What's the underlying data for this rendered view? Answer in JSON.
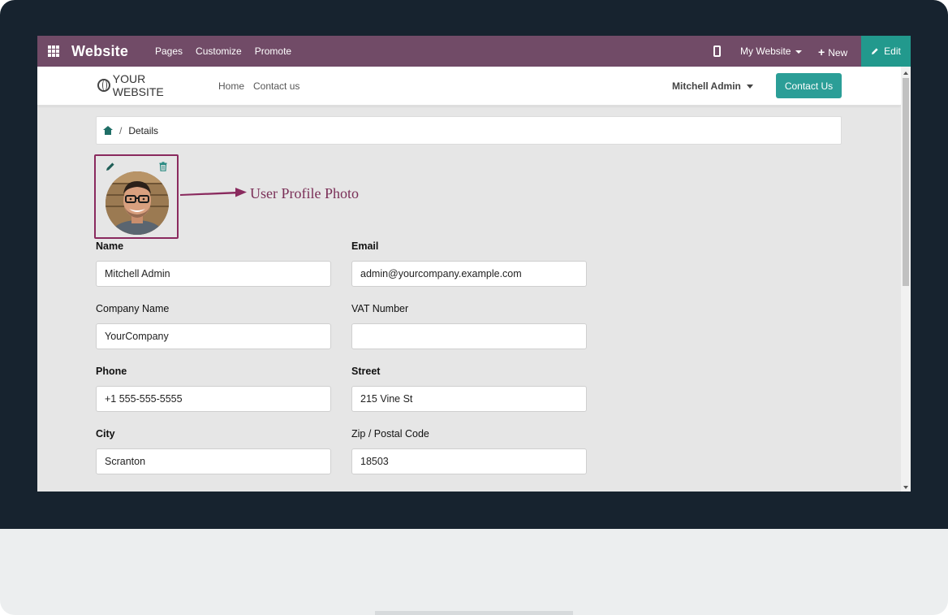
{
  "topbar": {
    "brand": "Website",
    "nav": [
      "Pages",
      "Customize",
      "Promote"
    ],
    "site_selector": "My Website",
    "new_label": "New",
    "edit_label": "Edit"
  },
  "site_header": {
    "logo_text": "YOUR WEBSITE",
    "nav": [
      "Home",
      "Contact us"
    ],
    "account_name": "Mitchell Admin",
    "contact_button": "Contact Us"
  },
  "breadcrumb": {
    "current": "Details"
  },
  "annotation": {
    "text": "User Profile Photo"
  },
  "form": {
    "fields": [
      {
        "label": "Name",
        "value": "Mitchell Admin",
        "required": true
      },
      {
        "label": "Email",
        "value": "admin@yourcompany.example.com",
        "required": true
      },
      {
        "label": "Company Name",
        "value": "YourCompany",
        "required": false
      },
      {
        "label": "VAT Number",
        "value": "",
        "required": false
      },
      {
        "label": "Phone",
        "value": "+1 555-555-5555",
        "required": true
      },
      {
        "label": "Street",
        "value": "215 Vine St",
        "required": true
      },
      {
        "label": "City",
        "value": "Scranton",
        "required": true
      },
      {
        "label": "Zip / Postal Code",
        "value": "18503",
        "required": false
      }
    ]
  },
  "colors": {
    "topbar": "#714b67",
    "edit": "#22998d",
    "contact_button": "#2b9e97",
    "annotation": "#7a2f57",
    "bezel": "#17232f"
  },
  "icons": [
    "apps-grid-icon",
    "mobile-preview-icon",
    "plus-icon",
    "pencil-icon",
    "globe-icon",
    "home-icon",
    "trash-icon",
    "arrow-icon"
  ]
}
